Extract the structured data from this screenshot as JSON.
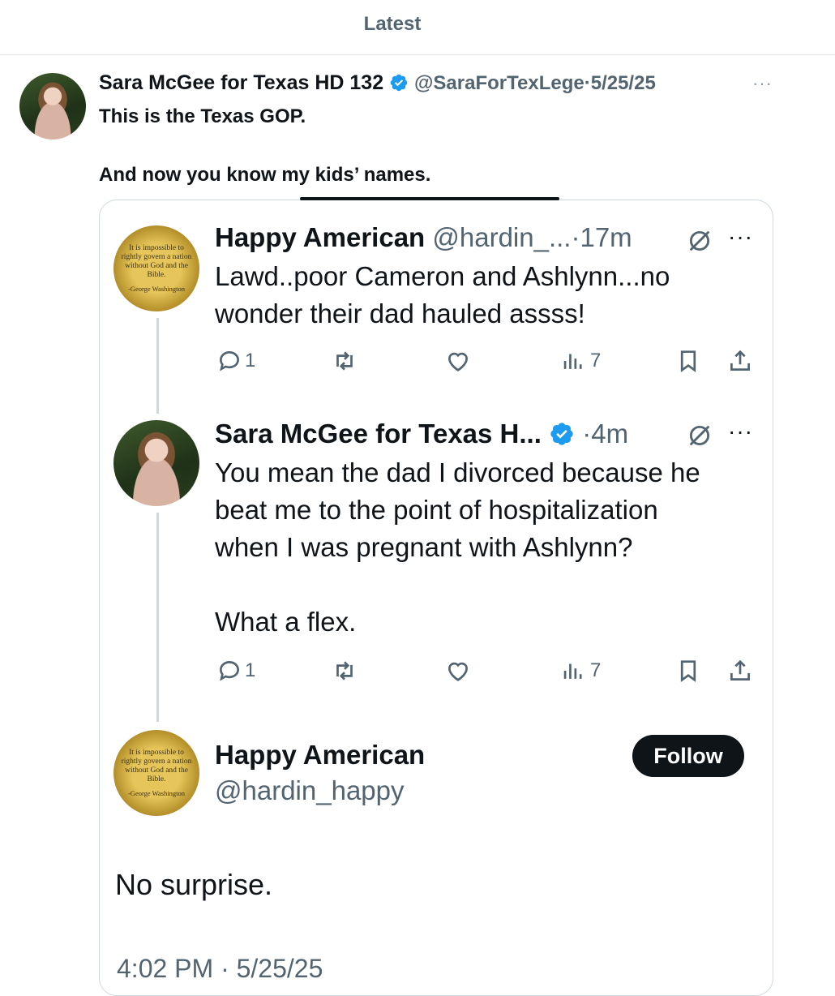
{
  "header": {
    "title": "Latest"
  },
  "tweet": {
    "author_name": "Sara McGee for Texas HD 132",
    "handle": "@SaraForTexLege",
    "date": "5/25/25",
    "text_line1": "This is the Texas GOP.",
    "text_line2": "And now you know my kids’ names."
  },
  "quoted": {
    "reply1": {
      "name": "Happy American",
      "handle": "@hardin_...",
      "time": "17m",
      "avatar_quote": "It is impossible to rightly govern a nation without God and the Bible.",
      "avatar_attrib": "-George Washington",
      "line1": "Lawd..poor Cameron and Ashlynn...no",
      "line2": "wonder their dad hauled assss!",
      "replies": "1",
      "views": "7"
    },
    "reply2": {
      "name": "Sara McGee for Texas H...",
      "time": "4m",
      "line1": "You mean the dad I divorced because he",
      "line2": "beat me to the point of hospitalization",
      "line3": "when I was pregnant with Ashlynn?",
      "line4": "What a flex.",
      "replies": "1",
      "views": "7"
    },
    "reply3": {
      "name": "Happy American",
      "handle": "@hardin_happy",
      "follow_label": "Follow",
      "avatar_quote": "It is impossible to rightly govern a nation without God and the Bible.",
      "avatar_attrib": "-George Washington",
      "text": "No surprise.",
      "timestamp": "4:02 PM · 5/25/25"
    }
  },
  "colors": {
    "verified": "#1d9bf0",
    "secondary_text": "#536471",
    "border": "#cfd9de"
  }
}
